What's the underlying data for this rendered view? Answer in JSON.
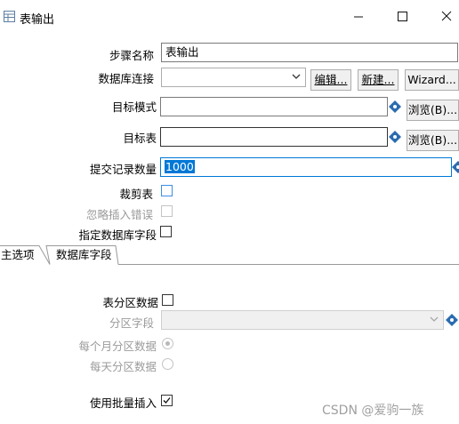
{
  "window": {
    "title": "表输出"
  },
  "form": {
    "step_name": {
      "label": "步骤名称",
      "value": "表输出"
    },
    "connection": {
      "label": "数据库连接",
      "value": "",
      "edit_btn": "编辑...",
      "new_btn": "新建...",
      "wizard_btn": "Wizard..."
    },
    "target_schema": {
      "label": "目标模式",
      "value": "",
      "browse_btn": "浏览(B)..."
    },
    "target_table": {
      "label": "目标表",
      "value": "",
      "browse_btn": "浏览(B)..."
    },
    "commit_size": {
      "label": "提交记录数量",
      "value": "1000"
    },
    "truncate_table": {
      "label": "裁剪表",
      "checked": false
    },
    "ignore_insert_errors": {
      "label": "忽略插入错误",
      "checked": false,
      "disabled": true
    },
    "specify_db_fields": {
      "label": "指定数据库字段",
      "checked": false
    }
  },
  "tabs": [
    {
      "label": "主选项",
      "active": true
    },
    {
      "label": "数据库字段",
      "active": false
    }
  ],
  "main_tab": {
    "partition_data": {
      "label": "表分区数据",
      "checked": false
    },
    "partition_field": {
      "label": "分区字段",
      "value": "",
      "disabled": true
    },
    "partition_monthly": {
      "label": "每个月分区数据",
      "selected": true,
      "disabled": true
    },
    "partition_daily": {
      "label": "每天分区数据",
      "selected": false,
      "disabled": true
    },
    "use_batch_insert": {
      "label": "使用批量插入",
      "checked": true
    }
  },
  "watermark": "CSDN @爱驹一族",
  "colors": {
    "accent": "#0078d7",
    "variable_icon": "#2b6cb0"
  }
}
